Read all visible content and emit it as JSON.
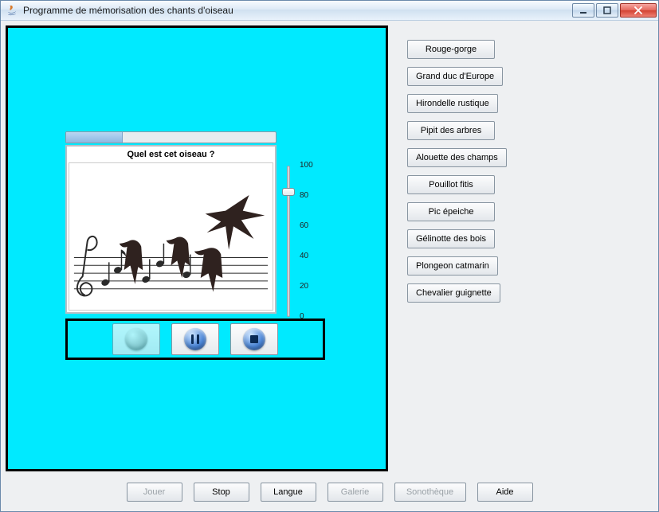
{
  "window": {
    "title": "Programme de mémorisation des chants d'oiseau"
  },
  "quiz": {
    "question": "Quel est cet oiseau ?",
    "progress_percent": 27
  },
  "slider": {
    "min": 0,
    "max": 100,
    "step": 20,
    "value": 82,
    "ticks": [
      "100",
      "80",
      "60",
      "40",
      "20",
      "0"
    ]
  },
  "media": {
    "play": "Play",
    "pause": "Pause",
    "stop": "Stop"
  },
  "birds": [
    "Rouge-gorge",
    "Grand duc d'Europe",
    "Hirondelle rustique",
    "Pipit des arbres",
    "Alouette des champs",
    "Pouillot fitis",
    "Pic épeiche",
    "Gélinotte des bois",
    "Plongeon catmarin",
    "Chevalier guignette"
  ],
  "bottom_buttons": [
    {
      "label": "Jouer",
      "enabled": false
    },
    {
      "label": "Stop",
      "enabled": true
    },
    {
      "label": "Langue",
      "enabled": true
    },
    {
      "label": "Galerie",
      "enabled": false
    },
    {
      "label": "Sonothèque",
      "enabled": false
    },
    {
      "label": "Aide",
      "enabled": true
    }
  ]
}
